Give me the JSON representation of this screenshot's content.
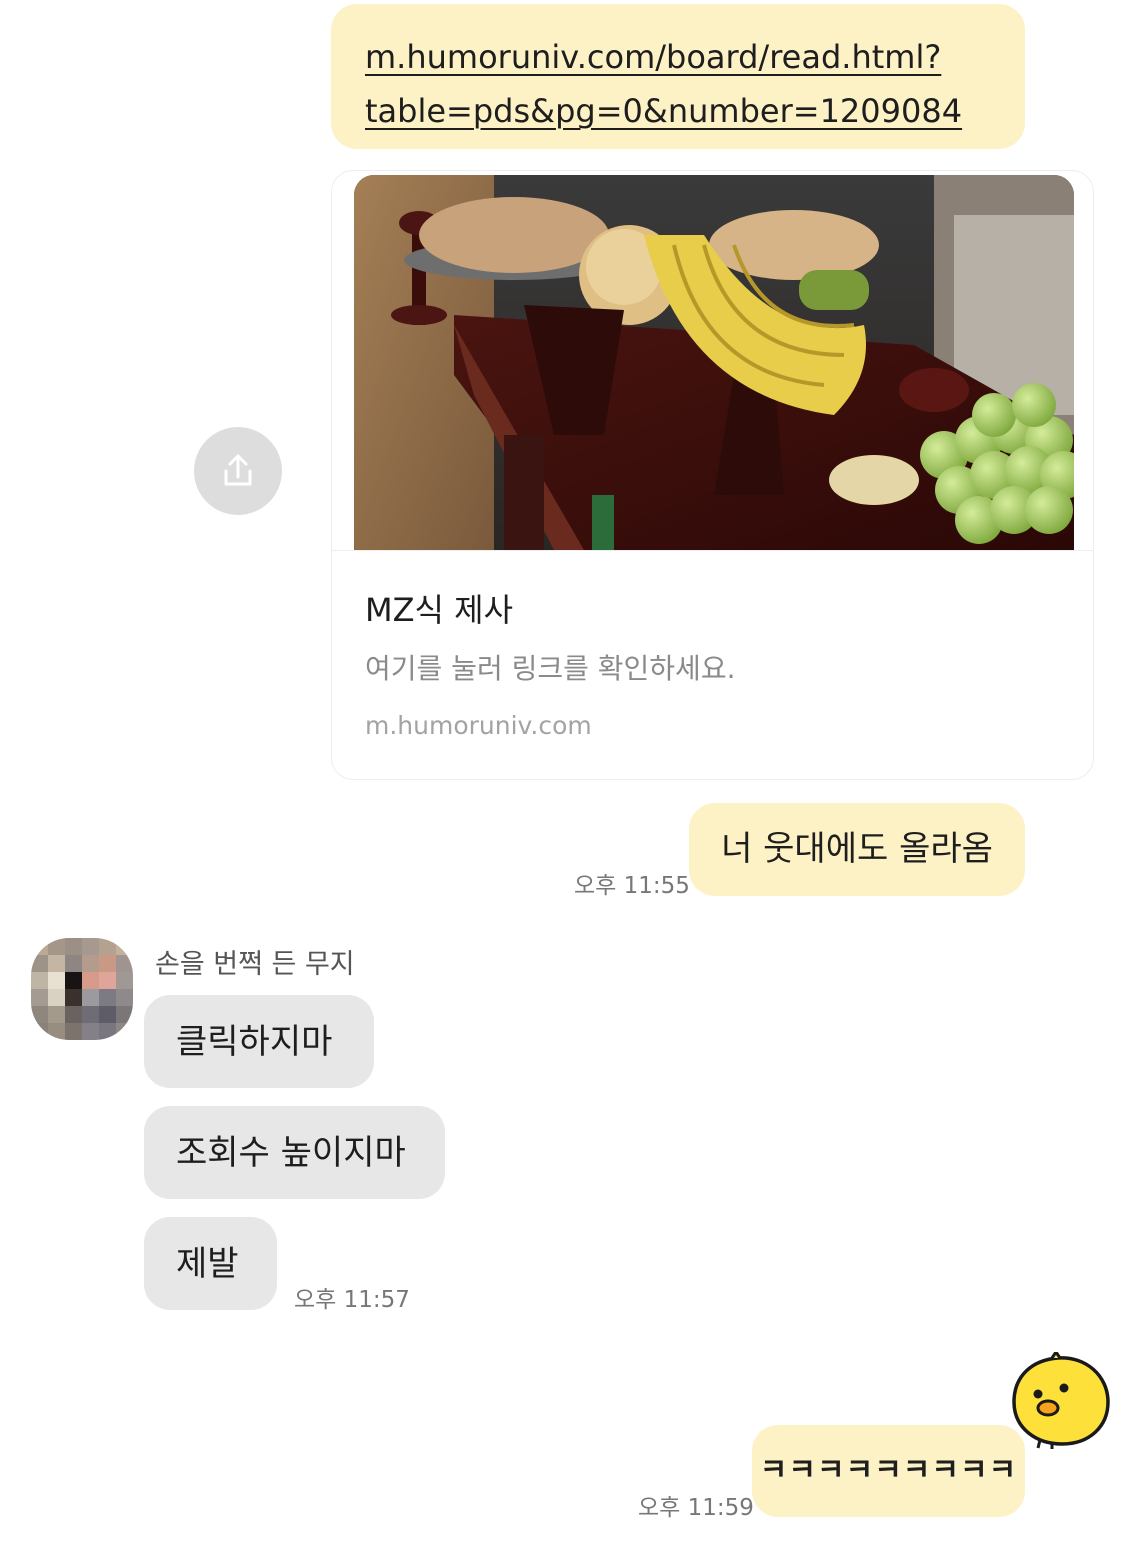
{
  "messages": {
    "link_url_line1": "m.humoruniv.com/board/read.html?",
    "link_url_line2": "table=pds&pg=0&number=1209084",
    "card_title": "MZ식 제사",
    "card_description": "여기를 눌러 링크를 확인하세요.",
    "card_domain": "m.humoruniv.com",
    "out_1": "너 웃대에도 올라옴",
    "out_1_time": "오후 11:55",
    "sender_name": "손을 번쩍 든 무지",
    "in_1": "클릭하지마",
    "in_2": "조회수 높이지마",
    "in_3": "제발",
    "in_3_time": "오후 11:57",
    "out_2": "ㅋㅋㅋㅋㅋㅋㅋㅋㅋ",
    "out_2_time": "오후 11:59"
  },
  "icons": {
    "share": "share-icon",
    "sticker": "chick-sticker"
  },
  "colors": {
    "outgoing_bubble": "#fdf1c6",
    "incoming_bubble": "#e7e7e7",
    "share_button": "#dddddd"
  }
}
